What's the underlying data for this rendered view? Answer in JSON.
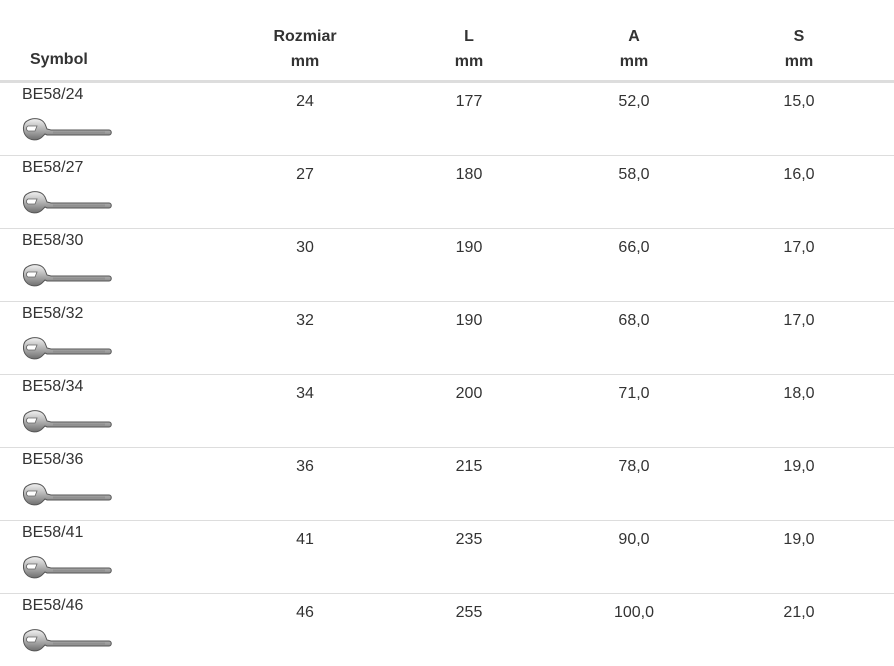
{
  "headers": {
    "symbol": "Symbol",
    "rozmiar": {
      "label": "Rozmiar",
      "unit": "mm"
    },
    "l": {
      "label": "L",
      "unit": "mm"
    },
    "a": {
      "label": "A",
      "unit": "mm"
    },
    "s": {
      "label": "S",
      "unit": "mm"
    }
  },
  "rows": [
    {
      "symbol": "BE58/24",
      "rozmiar": "24",
      "l": "177",
      "a": "52,0",
      "s": "15,0",
      "icon": "wrench-icon"
    },
    {
      "symbol": "BE58/27",
      "rozmiar": "27",
      "l": "180",
      "a": "58,0",
      "s": "16,0",
      "icon": "wrench-icon"
    },
    {
      "symbol": "BE58/30",
      "rozmiar": "30",
      "l": "190",
      "a": "66,0",
      "s": "17,0",
      "icon": "wrench-icon"
    },
    {
      "symbol": "BE58/32",
      "rozmiar": "32",
      "l": "190",
      "a": "68,0",
      "s": "17,0",
      "icon": "wrench-icon"
    },
    {
      "symbol": "BE58/34",
      "rozmiar": "34",
      "l": "200",
      "a": "71,0",
      "s": "18,0",
      "icon": "wrench-icon"
    },
    {
      "symbol": "BE58/36",
      "rozmiar": "36",
      "l": "215",
      "a": "78,0",
      "s": "19,0",
      "icon": "wrench-icon"
    },
    {
      "symbol": "BE58/41",
      "rozmiar": "41",
      "l": "235",
      "a": "90,0",
      "s": "19,0",
      "icon": "wrench-icon"
    },
    {
      "symbol": "BE58/46",
      "rozmiar": "46",
      "l": "255",
      "a": "100,0",
      "s": "21,0",
      "icon": "wrench-icon"
    }
  ]
}
